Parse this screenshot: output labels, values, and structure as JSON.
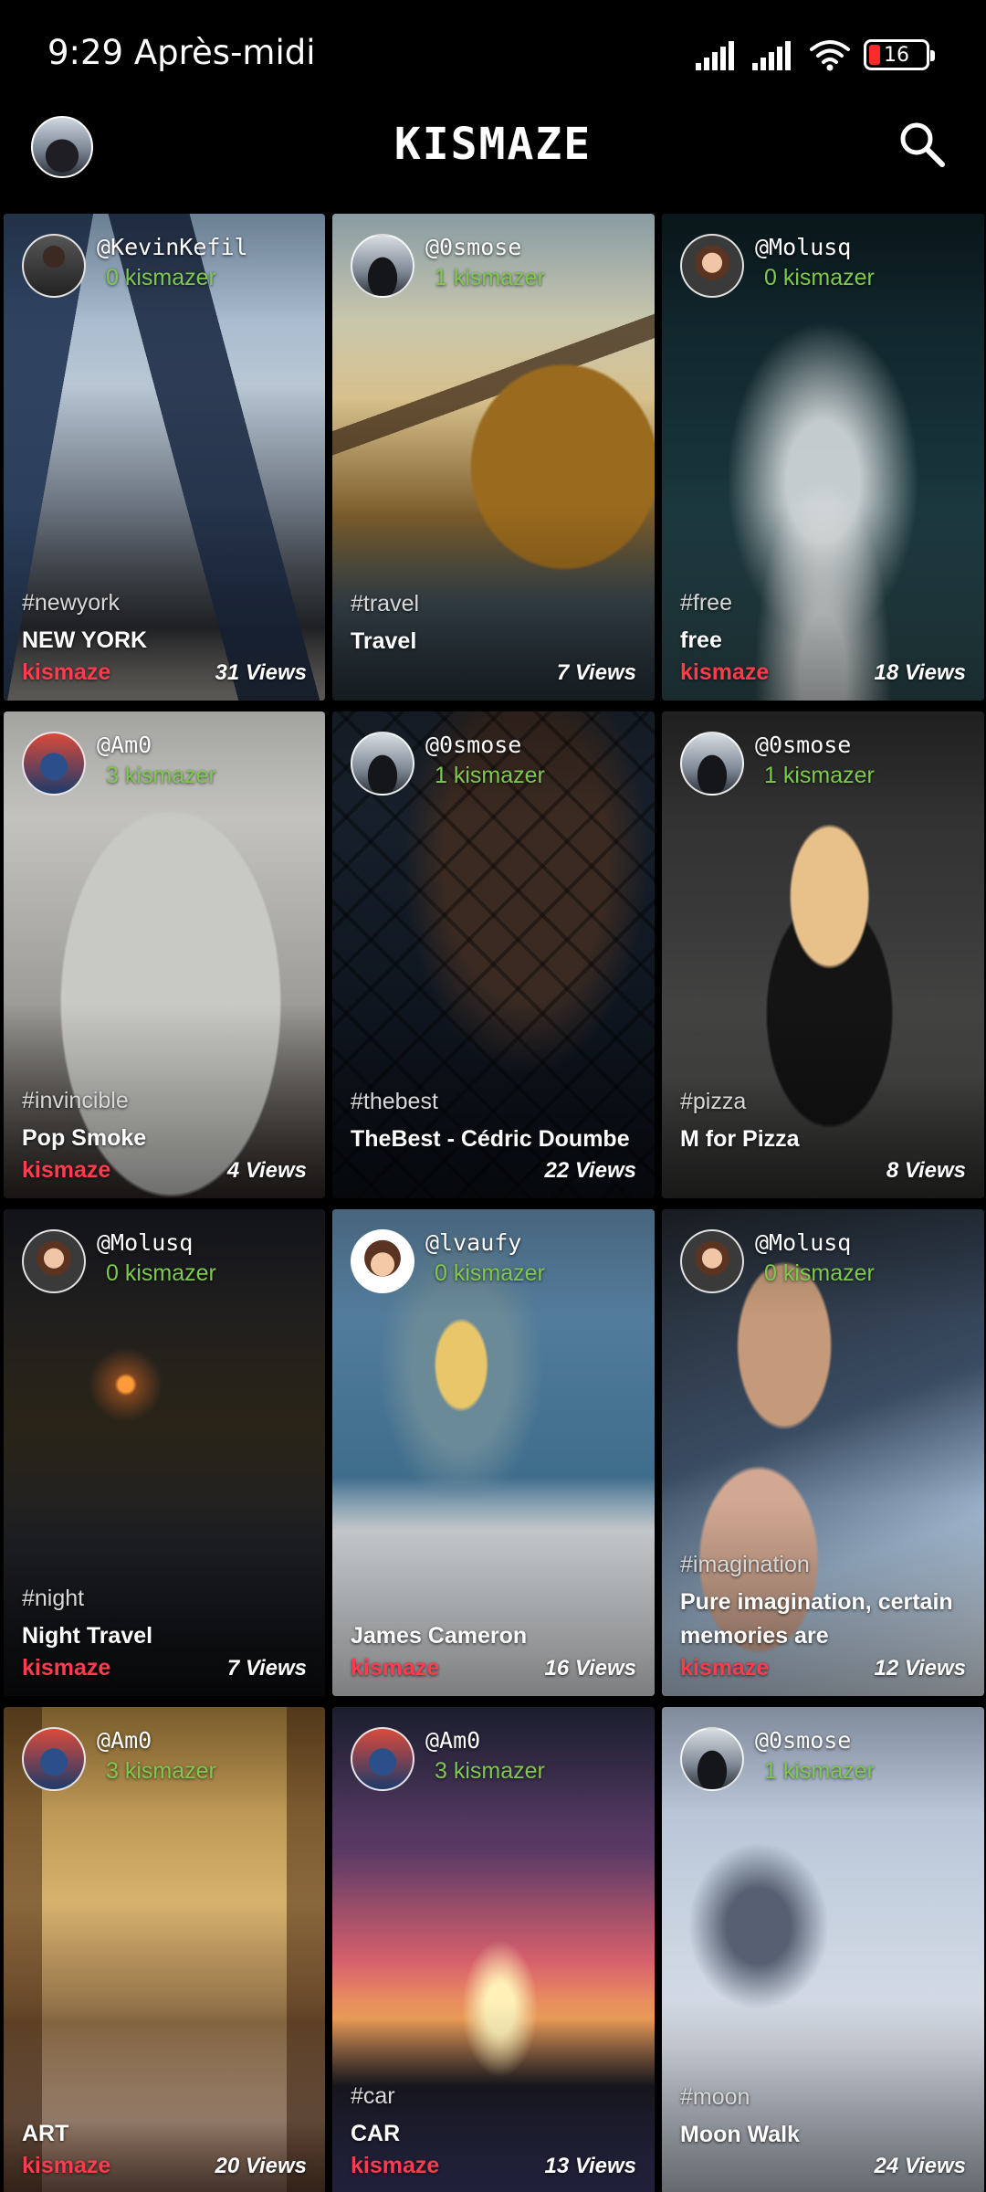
{
  "status_bar": {
    "time": "9:29 Après-midi",
    "battery": "16",
    "icons": [
      "signal-icon",
      "signal-icon",
      "wifi-icon",
      "battery-icon"
    ]
  },
  "header": {
    "title": "KISMAZE",
    "icons": [
      "profile-avatar",
      "search-icon"
    ]
  },
  "colors": {
    "background": "#000000",
    "kismazer_green": "#7ec850",
    "kismaze_red": "#ff3b4e",
    "battery_low": "#ff2b2b"
  },
  "cards": [
    {
      "username": "@KevinKefil",
      "kismazer": "0 kismazer",
      "tag": "#newyork",
      "caption": "NEW YORK",
      "kismaze": "kismaze",
      "views": "31 Views"
    },
    {
      "username": "@0smose",
      "kismazer": "1 kismazer",
      "tag": "#travel",
      "caption": "Travel",
      "kismaze": "",
      "views": "7 Views"
    },
    {
      "username": "@Molusq",
      "kismazer": "0 kismazer",
      "tag": "#free",
      "caption": "free",
      "kismaze": "kismaze",
      "views": "18 Views"
    },
    {
      "username": "@Am0",
      "kismazer": "3 kismazer",
      "tag": "#invincible",
      "caption": "Pop Smoke",
      "kismaze": "kismaze",
      "views": "4 Views"
    },
    {
      "username": "@0smose",
      "kismazer": "1 kismazer",
      "tag": "#thebest",
      "caption": "TheBest - Cédric Doumbe",
      "kismaze": "",
      "views": "22 Views"
    },
    {
      "username": "@0smose",
      "kismazer": "1 kismazer",
      "tag": "#pizza",
      "caption": "M for Pizza",
      "kismaze": "",
      "views": "8 Views"
    },
    {
      "username": "@Molusq",
      "kismazer": "0 kismazer",
      "tag": "#night",
      "caption": "Night Travel",
      "kismaze": "kismaze",
      "views": "7 Views"
    },
    {
      "username": "@lvaufy",
      "kismazer": "0 kismazer",
      "tag": "",
      "caption": "James Cameron",
      "kismaze": "kismaze",
      "views": "16 Views"
    },
    {
      "username": "@Molusq",
      "kismazer": "0 kismazer",
      "tag": "#imagination",
      "caption": "Pure imagination, certain memories are",
      "kismaze": "kismaze",
      "views": "12 Views"
    },
    {
      "username": "@Am0",
      "kismazer": "3 kismazer",
      "tag": "",
      "caption": "ART",
      "kismaze": "kismaze",
      "views": "20 Views"
    },
    {
      "username": "@Am0",
      "kismazer": "3 kismazer",
      "tag": "#car",
      "caption": "CAR",
      "kismaze": "kismaze",
      "views": "13 Views"
    },
    {
      "username": "@0smose",
      "kismazer": "1 kismazer",
      "tag": "#moon",
      "caption": "Moon Walk",
      "kismaze": "",
      "views": "24 Views"
    }
  ]
}
